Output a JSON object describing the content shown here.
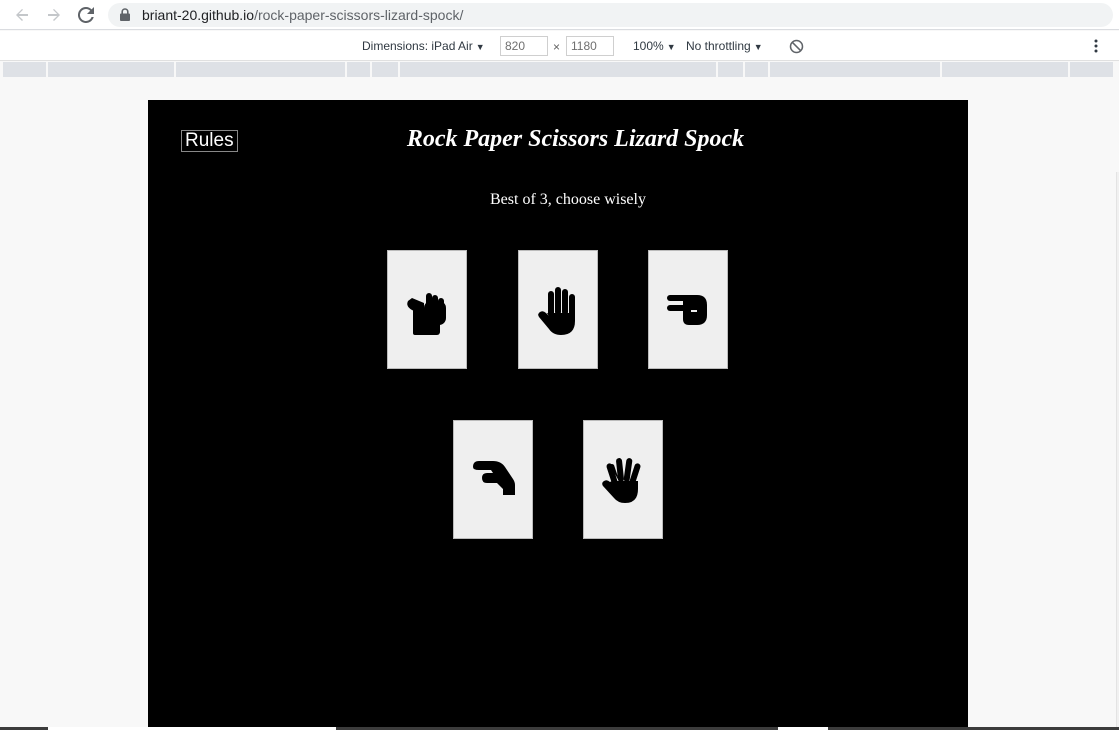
{
  "browser": {
    "url_host": "briant-20.github.io",
    "url_path": "/rock-paper-scissors-lizard-spock/",
    "back_icon": "arrow-left-icon",
    "forward_icon": "arrow-right-icon",
    "reload_icon": "reload-icon",
    "lock_icon": "lock-icon"
  },
  "devtools": {
    "dimensions_label": "Dimensions: iPad Air",
    "width_value": "820",
    "height_value": "1180",
    "times": "×",
    "zoom": "100%",
    "throttling": "No throttling",
    "caret": "▼"
  },
  "game": {
    "rules_label": "Rules",
    "title": "Rock Paper Scissors Lizard Spock",
    "subtitle": "Best of 3, choose wisely",
    "choices": [
      {
        "name": "rock",
        "icon": "hand-rock-icon"
      },
      {
        "name": "paper",
        "icon": "hand-paper-icon"
      },
      {
        "name": "scissors",
        "icon": "hand-scissors-icon"
      },
      {
        "name": "lizard",
        "icon": "hand-lizard-icon"
      },
      {
        "name": "spock",
        "icon": "hand-spock-icon"
      }
    ]
  },
  "colors": {
    "page_bg": "#000000",
    "card_bg": "#efefef",
    "text": "#ffffff"
  }
}
